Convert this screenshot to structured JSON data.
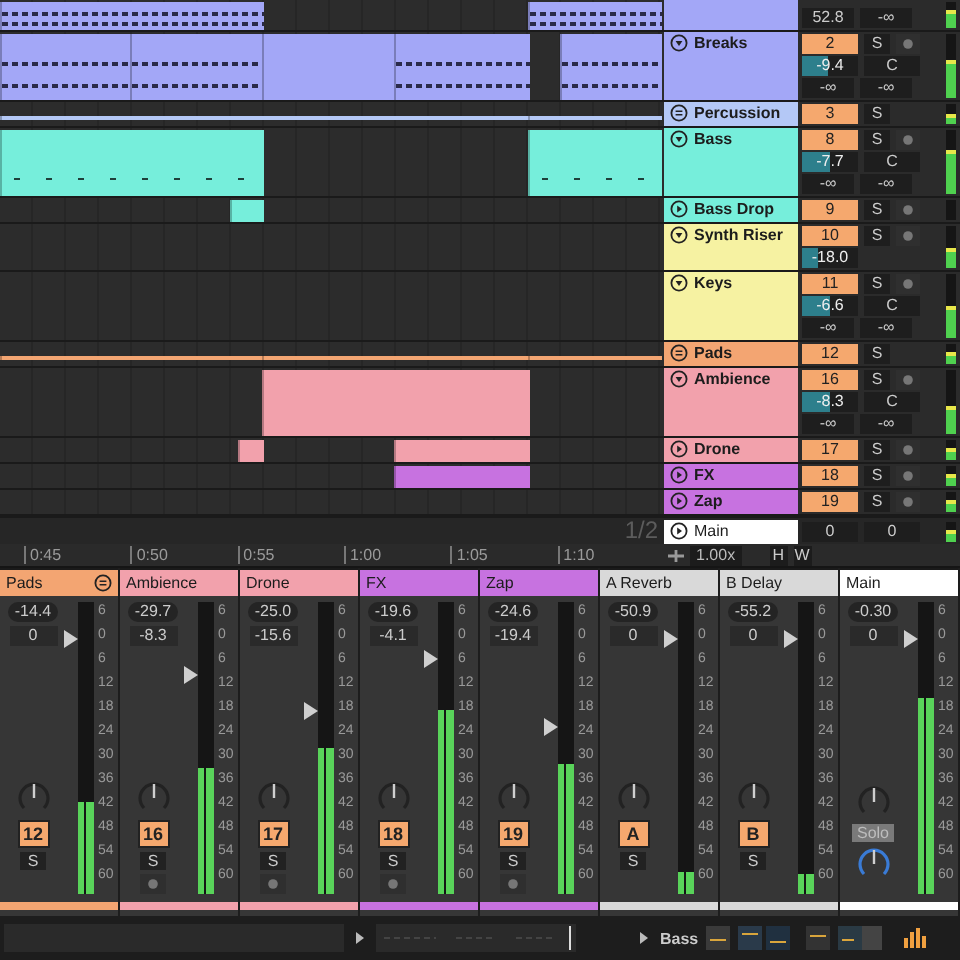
{
  "tracks": [
    {
      "kind": "cut",
      "color": "#a3a7f7",
      "sends": [
        "52.8",
        "-∞"
      ],
      "meter": {
        "level": 0.7
      }
    },
    {
      "kind": "track",
      "name": "Breaks",
      "color": "#a3a7f7",
      "expanded": true,
      "number": "2",
      "solo": "S",
      "volume": "-9.4",
      "level": 0.45,
      "pan": "C",
      "sends": [
        "-∞",
        "-∞"
      ],
      "meter": {
        "level": 0.6
      }
    },
    {
      "kind": "group",
      "name": "Percussion",
      "color": "#b4c8f6",
      "number": "3",
      "solo": "S",
      "meter": {
        "level": 0.5
      }
    },
    {
      "kind": "track",
      "name": "Bass",
      "color": "#76eedb",
      "expanded": true,
      "number": "8",
      "solo": "S",
      "volume": "-7.7",
      "level": 0.5,
      "pan": "C",
      "sends": [
        "-∞",
        "-∞"
      ],
      "meter": {
        "level": 0.7
      }
    },
    {
      "kind": "track",
      "name": "Bass Drop",
      "color": "#76eedb",
      "expanded": false,
      "number": "9",
      "solo": "S"
    },
    {
      "kind": "track",
      "name": "Synth Riser",
      "color": "#f6f2a2",
      "expanded": true,
      "number": "10",
      "solo": "S",
      "volume": "-18.0",
      "level": 0.3,
      "meter": {
        "level": 0.5
      }
    },
    {
      "kind": "track",
      "name": "Keys",
      "color": "#f6f2a2",
      "expanded": true,
      "number": "11",
      "solo": "S",
      "volume": "-6.6",
      "level": 0.5,
      "pan": "C",
      "sends": [
        "-∞",
        "-∞"
      ],
      "meter": {
        "level": 0.5
      }
    },
    {
      "kind": "group",
      "name": "Pads",
      "color": "#f3a572",
      "number": "12",
      "solo": "S",
      "meter": {
        "level": 0.6
      }
    },
    {
      "kind": "track",
      "name": "Ambience",
      "color": "#f2a1ac",
      "expanded": true,
      "number": "16",
      "solo": "S",
      "volume": "-8.3",
      "level": 0.5,
      "pan": "C",
      "sends": [
        "-∞",
        "-∞"
      ],
      "meter": {
        "level": 0.45
      }
    },
    {
      "kind": "track",
      "name": "Drone",
      "color": "#f2a1ac",
      "expanded": false,
      "number": "17",
      "solo": "S",
      "meter": {
        "level": 0.6
      }
    },
    {
      "kind": "track",
      "name": "FX",
      "color": "#c772e0",
      "expanded": false,
      "number": "18",
      "solo": "S",
      "meter": {
        "level": 0.6
      }
    },
    {
      "kind": "track",
      "name": "Zap",
      "color": "#c772e0",
      "expanded": false,
      "number": "19",
      "solo": "S",
      "meter": {
        "level": 0.6
      }
    }
  ],
  "main_row": {
    "page": "1/2",
    "name": "Main",
    "color": "#ffffff",
    "expanded": false,
    "volume": "0",
    "pan": "0",
    "meter": {
      "level": 0.6
    }
  },
  "ruler": {
    "ticks": [
      "0:45",
      "0:50",
      "0:55",
      "1:00",
      "1:05",
      "1:10"
    ],
    "zoom": "1.00x",
    "buttons": [
      "H",
      "W"
    ]
  },
  "mixer": {
    "strips": [
      {
        "kind": "group",
        "name": "Pads",
        "color": "#f3a572",
        "peak": "-14.4",
        "volume": "0",
        "fader": {
          "level": 0.9
        },
        "meter": {
          "level": 0.32
        },
        "scale": [
          "6",
          "0",
          "6",
          "12",
          "18",
          "24",
          "30",
          "36",
          "42",
          "48",
          "54",
          "60"
        ],
        "number": "12",
        "solo": "S"
      },
      {
        "kind": "track",
        "name": "Ambience",
        "color": "#f2a1ac",
        "peak": "-29.7",
        "volume": "-8.3",
        "fader": {
          "level": 0.77
        },
        "meter": {
          "level": 0.43
        },
        "scale": [
          "6",
          "0",
          "6",
          "12",
          "18",
          "24",
          "30",
          "36",
          "42",
          "48",
          "54",
          "60"
        ],
        "number": "16",
        "solo": "S"
      },
      {
        "kind": "track",
        "name": "Drone",
        "color": "#f2a1ac",
        "peak": "-25.0",
        "volume": "-15.6",
        "fader": {
          "level": 0.64
        },
        "meter": {
          "level": 0.5
        },
        "scale": [
          "6",
          "0",
          "6",
          "12",
          "18",
          "24",
          "30",
          "36",
          "42",
          "48",
          "54",
          "60"
        ],
        "number": "17",
        "solo": "S"
      },
      {
        "kind": "track",
        "name": "FX",
        "color": "#c772e0",
        "peak": "-19.6",
        "volume": "-4.1",
        "fader": {
          "level": 0.83
        },
        "meter": {
          "level": 0.63
        },
        "scale": [
          "6",
          "0",
          "6",
          "12",
          "18",
          "24",
          "30",
          "36",
          "42",
          "48",
          "54",
          "60"
        ],
        "number": "18",
        "solo": "S"
      },
      {
        "kind": "track",
        "name": "Zap",
        "color": "#c772e0",
        "peak": "-24.6",
        "volume": "-19.4",
        "fader": {
          "level": 0.58
        },
        "meter": {
          "level": 0.45
        },
        "scale": [
          "6",
          "0",
          "6",
          "12",
          "18",
          "24",
          "30",
          "36",
          "42",
          "48",
          "54",
          "60"
        ],
        "number": "19",
        "solo": "S"
      },
      {
        "kind": "return",
        "name": "A Reverb",
        "color": "#d9d9d9",
        "peak": "-50.9",
        "volume": "0",
        "fader": {
          "level": 0.9
        },
        "meter": {
          "level": 0.08
        },
        "scale": [
          "6",
          "0",
          "6",
          "12",
          "18",
          "24",
          "30",
          "36",
          "42",
          "48",
          "54",
          "60"
        ],
        "number": "A",
        "solo": "S"
      },
      {
        "kind": "return",
        "name": "B Delay",
        "color": "#d9d9d9",
        "peak": "-55.2",
        "volume": "0",
        "fader": {
          "level": 0.9
        },
        "meter": {
          "level": 0.07
        },
        "scale": [
          "6",
          "0",
          "6",
          "12",
          "18",
          "24",
          "30",
          "36",
          "42",
          "48",
          "54",
          "60"
        ],
        "number": "B",
        "solo": "S"
      },
      {
        "kind": "main",
        "name": "Main",
        "color": "#ffffff",
        "peak": "-0.30",
        "volume": "0",
        "fader": {
          "level": 0.9
        },
        "meter": {
          "level": 0.67
        },
        "scale": [
          "6",
          "0",
          "6",
          "12",
          "18",
          "24",
          "30",
          "36",
          "42",
          "48",
          "54",
          "60"
        ],
        "solo_button": "Solo"
      }
    ]
  },
  "footer": {
    "track": "Bass"
  }
}
